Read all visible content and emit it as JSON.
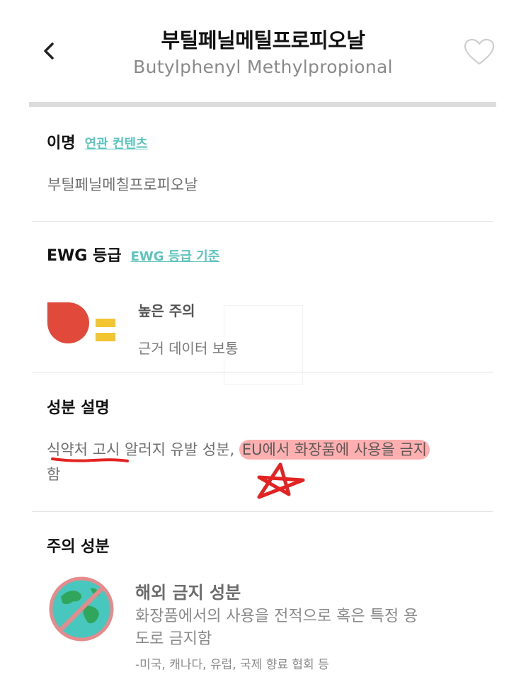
{
  "header": {
    "back_icon": "chevron-left-icon",
    "title_ko": "부틸페닐메틸프로피오날",
    "title_en": "Butylphenyl Methylpropional",
    "favorite_icon": "heart-outline-icon"
  },
  "alias_section": {
    "title": "이명",
    "link": "연관 컨텐츠",
    "value": "부틸페닐메칠프로피오날"
  },
  "ewg_section": {
    "title": "EWG 등급",
    "link": "EWG 등급 기준",
    "grade_icon": "ewg-grade-drop-icon",
    "data_icon": "data-level-bars-icon",
    "grade_label": "높은 주의",
    "data_label": "근거 데이터 보통",
    "colors": {
      "drop": "#e1493a",
      "bars": "#f2c531"
    }
  },
  "description_section": {
    "title": "성분 설명",
    "text_part1": "식약처 고시",
    "text_part2": " 알러지 유발 성분, ",
    "text_part3": "EU에서 화장품에 사용을 금지",
    "text_part4": "함"
  },
  "caution_section": {
    "title": "주의 성분",
    "ban_icon": "globe-ban-icon",
    "ban_title": "해외 금지 성분",
    "ban_desc_line1": "화장품에서의 사용을 전적으로 혹은 특정 용",
    "ban_desc_line2": "도로 금지함",
    "ban_examples": "-미국, 캐나다, 유럽, 국제 향료 협회 등"
  },
  "annotations": {
    "underline_color": "#e32222",
    "highlight_color": "#ff7070",
    "star_icon": "hand-drawn-star-icon"
  }
}
